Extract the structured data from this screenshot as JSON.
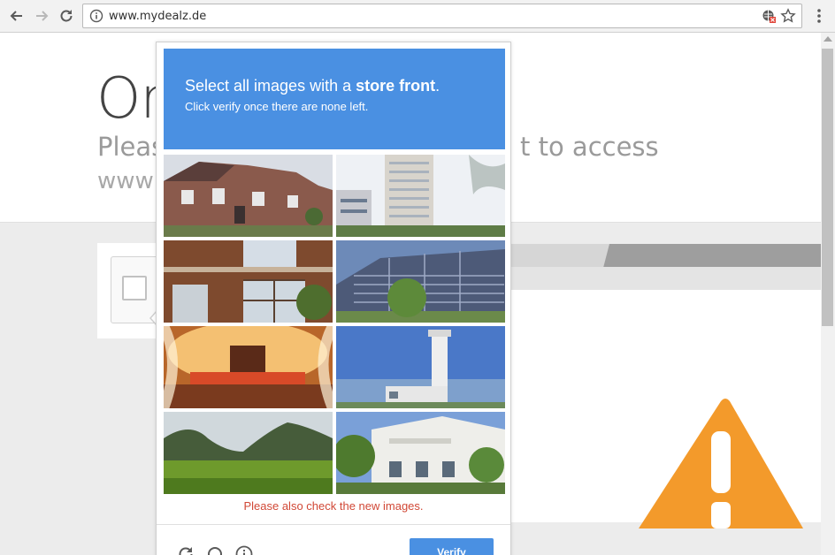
{
  "browser": {
    "url": "www.mydealz.de"
  },
  "page": {
    "title": "Or",
    "subtitle_left": "Pleas",
    "subtitle_right": "t to access",
    "subtitle_line2": "www"
  },
  "captcha": {
    "prompt_prefix": "Select all images with a ",
    "prompt_bold": "store front",
    "prompt_suffix": ".",
    "instruction": "Click verify once there are none left.",
    "error": "Please also check the new images.",
    "verify_label": "Verify",
    "tiles": [
      "brick-house",
      "tall-building",
      "brick-wall-window",
      "office-block",
      "lit-stage",
      "lighthouse",
      "green-hills",
      "white-villa"
    ]
  },
  "colors": {
    "accent": "#4a90e2",
    "error": "#d14836",
    "warning": "#f39a2b"
  }
}
